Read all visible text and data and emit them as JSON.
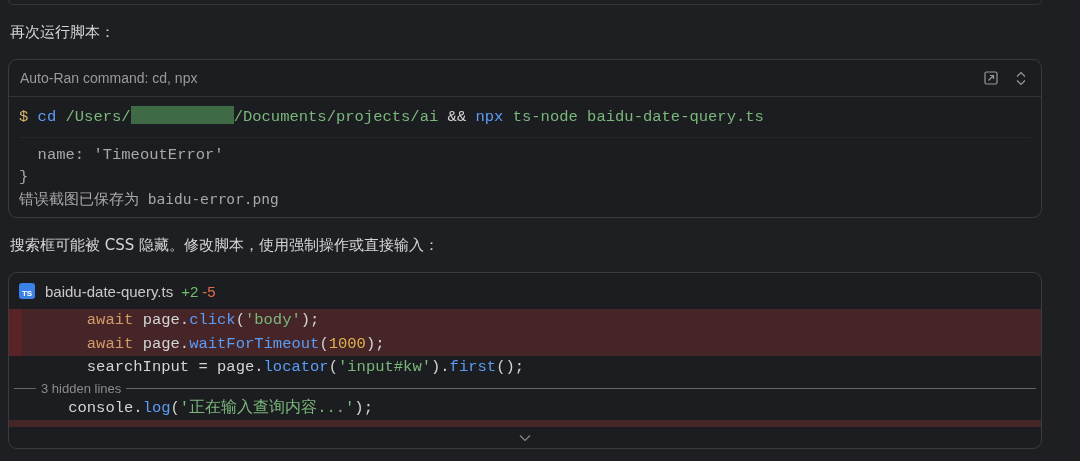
{
  "paragraphs": [
    "再次运行脚本：",
    "搜索框可能被 CSS 隐藏。修改脚本，使用强制操作或直接输入："
  ],
  "terminal": {
    "title": "Auto-Ran command: cd, npx",
    "lines": [
      {
        "tokens": [
          {
            "text": "$ ",
            "kind": "prompt"
          },
          {
            "text": "cd",
            "kind": "command"
          },
          {
            "text": " /Users/",
            "kind": "path"
          },
          {
            "kind": "redacted"
          },
          {
            "text": "/Documents/projects/ai",
            "kind": "path"
          },
          {
            "text": " && ",
            "kind": "plain"
          },
          {
            "text": "npx",
            "kind": "command"
          },
          {
            "text": " ts-node baidu-date-query.ts",
            "kind": "path"
          }
        ]
      },
      {
        "tokens": [
          {
            "text": "  name: 'TimeoutError'",
            "kind": "output"
          }
        ]
      },
      {
        "tokens": [
          {
            "text": "}",
            "kind": "output"
          }
        ]
      },
      {
        "tokens": [
          {
            "text": "错误截图已保存为 baidu-error.png",
            "kind": "output"
          }
        ]
      }
    ]
  },
  "diff": {
    "icon_label": "TS",
    "filename": "baidu-date-query.ts",
    "added": "+2",
    "removed": "-5",
    "hidden": "3 hidden lines",
    "lines": [
      {
        "kind": "removed",
        "tokens": [
          {
            "text": "      await",
            "kind": "keyword"
          },
          {
            "text": " page.",
            "kind": "plain"
          },
          {
            "text": "click",
            "kind": "function"
          },
          {
            "text": "(",
            "kind": "plain"
          },
          {
            "text": "'body'",
            "kind": "string"
          },
          {
            "text": ");",
            "kind": "plain"
          }
        ]
      },
      {
        "kind": "removed",
        "tokens": [
          {
            "text": "      await",
            "kind": "keyword"
          },
          {
            "text": " page.",
            "kind": "plain"
          },
          {
            "text": "waitForTimeout",
            "kind": "function"
          },
          {
            "text": "(",
            "kind": "plain"
          },
          {
            "text": "1000",
            "kind": "number"
          },
          {
            "text": ");",
            "kind": "plain"
          }
        ]
      },
      {
        "kind": "context",
        "tokens": [
          {
            "text": "      searchInput = page.",
            "kind": "plain"
          },
          {
            "text": "locator",
            "kind": "function"
          },
          {
            "text": "(",
            "kind": "plain"
          },
          {
            "text": "'input#kw'",
            "kind": "string"
          },
          {
            "text": ").",
            "kind": "plain"
          },
          {
            "text": "first",
            "kind": "function"
          },
          {
            "text": "();",
            "kind": "plain"
          }
        ]
      },
      {
        "kind": "hidden"
      },
      {
        "kind": "context",
        "tokens": [
          {
            "text": "    console.",
            "kind": "plain"
          },
          {
            "text": "log",
            "kind": "function"
          },
          {
            "text": "(",
            "kind": "plain"
          },
          {
            "text": "'正在输入查询内容...'",
            "kind": "string"
          },
          {
            "text": ");",
            "kind": "plain"
          }
        ]
      }
    ]
  }
}
